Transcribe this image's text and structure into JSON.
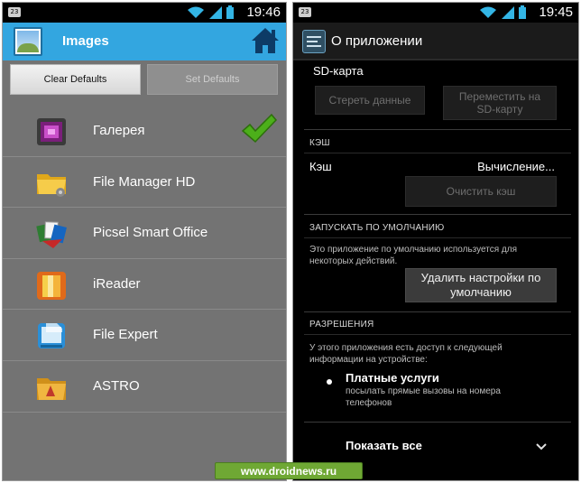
{
  "left": {
    "status": {
      "time": "19:46",
      "notification_label": "23"
    },
    "header": {
      "title": "Images"
    },
    "buttons": {
      "clear": "Clear Defaults",
      "set": "Set Defaults"
    },
    "apps": [
      {
        "label": "Галерея",
        "icon": "gallery-icon",
        "selected": true
      },
      {
        "label": "File Manager HD",
        "icon": "folder-icon",
        "selected": false
      },
      {
        "label": "Picsel Smart Office",
        "icon": "office-icon",
        "selected": false
      },
      {
        "label": "iReader",
        "icon": "book-icon",
        "selected": false
      },
      {
        "label": "File Expert",
        "icon": "file-expert-icon",
        "selected": false
      },
      {
        "label": "ASTRO",
        "icon": "astro-folder-icon",
        "selected": false
      }
    ],
    "colors": {
      "header": "#33a6e0",
      "background": "#737373",
      "check": "#4caf1a"
    }
  },
  "right": {
    "status": {
      "time": "19:45",
      "notification_label": "23"
    },
    "header": {
      "title": "О приложении"
    },
    "storage": {
      "label": "SD-карта",
      "clear_data": "Стереть данные",
      "move_to_sd": "Переместить на SD-карту"
    },
    "cache": {
      "section": "КЭШ",
      "label": "Кэш",
      "value": "Вычисление...",
      "clear_cache": "Очистить кэш"
    },
    "launch": {
      "section": "ЗАПУСКАТЬ ПО УМОЛЧАНИЮ",
      "description": "Это приложение по умолчанию используется для некоторых действий.",
      "clear_defaults": "Удалить настройки по умолчанию"
    },
    "permissions": {
      "section": "РАЗРЕШЕНИЯ",
      "description": "У этого приложения есть доступ к следующей информации на устройстве:",
      "item_title": "Платные услуги",
      "item_desc": "посылать прямые вызовы на номера телефонов",
      "show_all": "Показать все"
    }
  },
  "watermark": "www.droidnews.ru"
}
